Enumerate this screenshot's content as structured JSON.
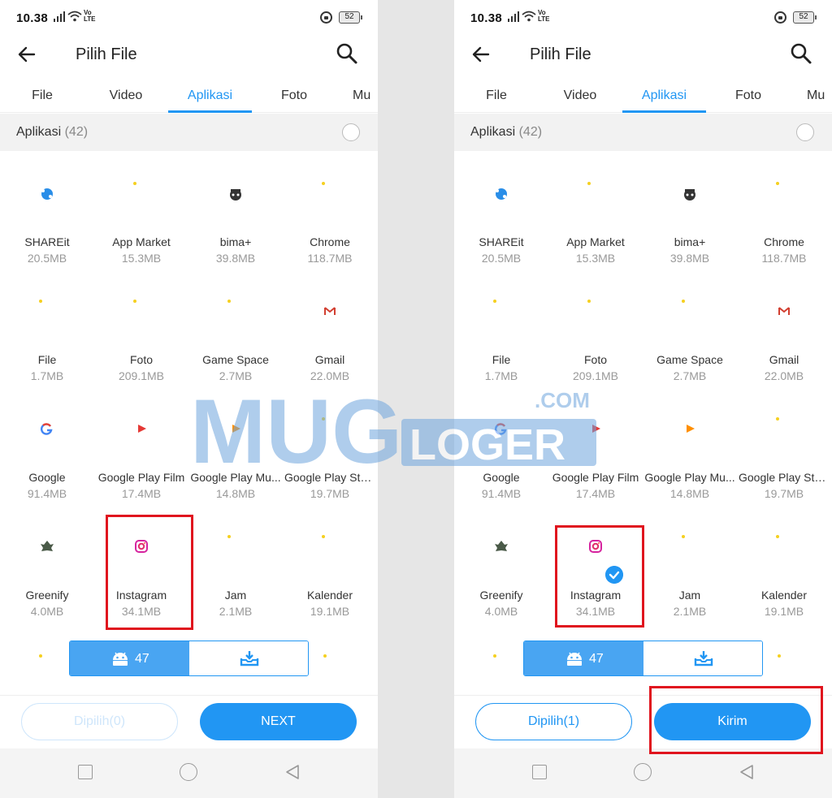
{
  "status": {
    "time": "10.38",
    "volte_top": "Vo",
    "volte_bottom": "LTE",
    "battery": "52"
  },
  "header": {
    "title": "Pilih File",
    "back_icon": "arrow-left-icon",
    "search_icon": "search-icon"
  },
  "tabs": [
    {
      "label": "File",
      "active": false
    },
    {
      "label": "Video",
      "active": false
    },
    {
      "label": "Aplikasi",
      "active": true
    },
    {
      "label": "Foto",
      "active": false
    },
    {
      "label": "Mu",
      "active": false
    }
  ],
  "section": {
    "label": "Aplikasi",
    "count": "(42)"
  },
  "apps": [
    {
      "name": "SHAREit",
      "size": "20.5MB",
      "icon": "shareit-icon"
    },
    {
      "name": "App Market",
      "size": "15.3MB",
      "icon": "app-market-icon"
    },
    {
      "name": "bima+",
      "size": "39.8MB",
      "icon": "bima-icon"
    },
    {
      "name": "Chrome",
      "size": "118.7MB",
      "icon": "chrome-icon"
    },
    {
      "name": "File",
      "size": "1.7MB",
      "icon": "file-icon"
    },
    {
      "name": "Foto",
      "size": "209.1MB",
      "icon": "foto-icon"
    },
    {
      "name": "Game Space",
      "size": "2.7MB",
      "icon": "game-space-icon"
    },
    {
      "name": "Gmail",
      "size": "22.0MB",
      "icon": "gmail-icon"
    },
    {
      "name": "Google",
      "size": "91.4MB",
      "icon": "google-icon"
    },
    {
      "name": "Google Play Film",
      "size": "17.4MB",
      "icon": "play-film-icon"
    },
    {
      "name": "Google Play Mu...",
      "size": "14.8MB",
      "icon": "play-music-icon"
    },
    {
      "name": "Google Play Sto...",
      "size": "19.7MB",
      "icon": "play-store-icon"
    },
    {
      "name": "Greenify",
      "size": "4.0MB",
      "icon": "greenify-icon"
    },
    {
      "name": "Instagram",
      "size": "34.1MB",
      "icon": "instagram-icon"
    },
    {
      "name": "Jam",
      "size": "2.1MB",
      "icon": "jam-icon"
    },
    {
      "name": "Kalender",
      "size": "19.1MB",
      "icon": "kalender-icon"
    }
  ],
  "segment": {
    "count": "47",
    "left_icon": "android-icon",
    "right_icon": "download-tray-icon"
  },
  "left_screen": {
    "selected_label": "Dipilih(0)",
    "primary_label": "NEXT",
    "instagram_checked": false
  },
  "right_screen": {
    "selected_label": "Dipilih(1)",
    "primary_label": "Kirim",
    "instagram_checked": true
  },
  "watermark": {
    "brand_left": "MUG",
    "brand_right": "LOGER",
    "suffix": ".COM"
  },
  "colors": {
    "accent": "#2196F3",
    "highlight": "#E0141E",
    "segment_fill": "#49A5F2"
  }
}
